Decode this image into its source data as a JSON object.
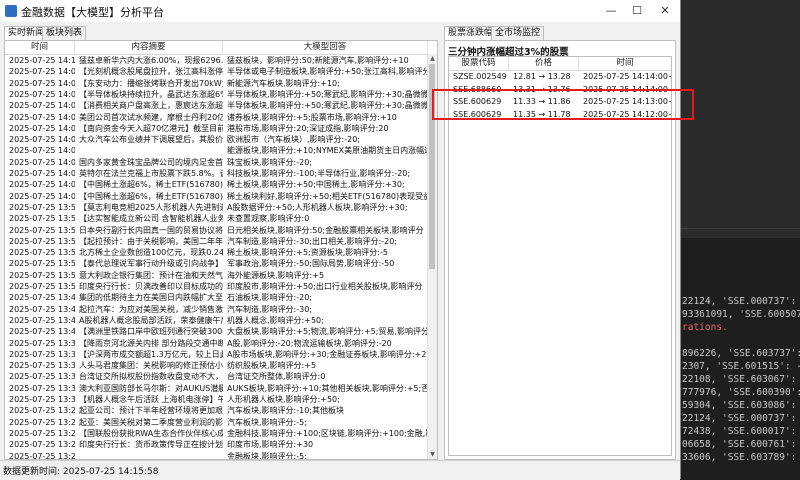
{
  "window": {
    "title": "金融数据【大模型】分析平台",
    "controls": {
      "minimize": "—",
      "maximize": "☐",
      "close": "✕"
    }
  },
  "left_tabs": [
    {
      "label": "实时新闻",
      "active": true
    },
    {
      "label": "板块列表",
      "active": false
    }
  ],
  "right_tabs": [
    {
      "label": "股票涨跌幅",
      "active": true
    },
    {
      "label": "全市场监控",
      "active": false
    }
  ],
  "news_table": {
    "columns": [
      "时间",
      "内容摘要",
      "大模型回答"
    ],
    "rows": [
      [
        "2025-07-25 14:11",
        "猛兹卓新华六内大涨6.00%，现报6296.00元/",
        "猛兹板块，影响评分:50;新能源汽车,影响评分:+10"
      ],
      [
        "2025-07-25 14:08",
        "【光刻机概念股尾盘拉升，张江高科涨停】光刻",
        "半导体或电子制造板块,影响评分:+50;张江高科,影响评分:+10"
      ],
      [
        "2025-07-25 14:07",
        "【东安动力：播缩张烤联合开发出70kW大功率",
        "新能源汽车板块,影响评分:+10;"
      ],
      [
        "2025-07-25 14:06",
        "【半导体板块持续拉升，晶武达东涨超6%】半导",
        "半导体板块,影响评分:+50;寒武纪,影响评分:+30;晶微微微,影响评分"
      ],
      [
        "2025-07-25 14:06",
        "【消费相关商户盘高涨上，惠宸达东涨超6%】半导",
        "半导体板块,影响评分:+50;寒武纪,影响评分:+30;晶微微微,影响评分"
      ],
      [
        "2025-07-25 14:05",
        "美团公司首次试水频建，摩根士丹利20亿元人",
        "诸券板块,影响评分:+5;股票市场,影响评分:+10"
      ],
      [
        "2025-07-25 14:04",
        "【南向资金今天入超70亿港元】截至目前，南向",
        "港股市场,影响评分:20;深证成指,影响评分:20"
      ],
      [
        "2025-07-25 14:04",
        "大众汽车公布业绩并下调展望后，其股价在法兰",
        "欧洲股市（汽车板块）,影响评分:-20;"
      ],
      [
        "2025-07-25 14:04",
        "",
        "能源板块,影响评分:+10;NYMEX美原油期货主日内涨幅达到1.08"
      ],
      [
        "2025-07-25 14:04",
        "国内多家黄金珠宝品牌公司的境内足金首饰价格",
        "珠宝板块,影响评分:-20;"
      ],
      [
        "2025-07-25 14:00",
        "英特尔在法兰克福上市股票下跌5.8%。该公司",
        "科技板块,影响评分:-100;半导体行业,影响评分:-20;"
      ],
      [
        "2025-07-25 14:00",
        "【中国稀土涨超6%，稀土ETF(516780)持有该股",
        "稀土板块,影响评分:+50;中国稀土,影响评分:+30;"
      ],
      [
        "2025-07-25 14:00",
        "【中国稀土涨超6%，稀土ETF(516780)持有该股",
        "稀土板块利好,影响评分:+50;相关ETF(516780)表现受益,影响评分"
      ],
      [
        "2025-07-25 13:59",
        "【莫志利电竞相2025人形机器人先进制造技术论",
        "A股数据评分:+50;人形机器人板块,影响评分:+30;"
      ],
      [
        "2025-07-25 13:56",
        "【达实智能成立新公司 含智能机器人业务】企",
        "未查置观察,影响评分:0"
      ],
      [
        "2025-07-25 13:56",
        "日本央行副行长内田真一国的贸易协议将减少不确",
        "日元相关板块,影响评分:50;金融股票相关板块,影响评分"
      ],
      [
        "2025-07-25 13:56",
        "【起拉预计：由于关税影响，美国二年年度汽车",
        "汽车制造,影响评分:-30;出口相关,影响评分:-20;"
      ],
      [
        "2025-07-25 13:54",
        "北方稀土企业数创造100亿元，现跌0.24%。",
        "稀土板块,影响评分:+5;资源板块,影响评分:-5"
      ],
      [
        "2025-07-25 13:54",
        "【泰代总理说军事行动升级或引向战争】泰国CCT",
        "军事政治,影响评分:-50;国际局势,影响评分:-50"
      ],
      [
        "2025-07-25 13:54",
        "意大利政企银行集团：预计在油和天然气产量将",
        "海外能源板块,影响评分:+5"
      ],
      [
        "2025-07-25 13:54",
        "印度央行行长：贝满改善印以目标成功的。",
        "印度股市,影响评分:+50;出口行业相关股板块,影响评分"
      ],
      [
        "2025-07-25 13:45",
        "集团的低期待主力在美国日内跌幅扩大至4%。",
        "石油板块,影响评分:-20;"
      ],
      [
        "2025-07-25 13:45",
        "起拉汽车：为应对美国关税，减少销售激励措施",
        "汽车制造,影响评分:-30;"
      ],
      [
        "2025-07-25 13:44",
        "A股机器人概念股局部活跃，荣泰健康午后涨停，",
        "机器人概念,影响评分:+50;"
      ],
      [
        "2025-07-25 13:42",
        "【满洲里铁路口岸中欧班列通行突破30000列】",
        "大盘板块,影响评分:+5;物流,影响评分:+5;贸易,影响评分:+5"
      ],
      [
        "2025-07-25 13:39",
        "【降雨京河北源关内排 部分路段交通中断】7月",
        "A股,影响评分:-20;物流运输板块,影响评分:-20"
      ],
      [
        "2025-07-25 13:39",
        "【沪深两市成交额超1.3万亿元，较上日此时增",
        "A股市场板块,影响评分:+30;金融证券板块,影响评分:+20"
      ],
      [
        "2025-07-25 13:39",
        "人头马君度集团：关税影响的修正预估小于预期",
        "纺织股板块,影响评分:+5"
      ],
      [
        "2025-07-25 13:34",
        "台湾证交所拟权股份指数收盘变动不大，报23,3",
        "台湾证交所整体,影响评分:0"
      ],
      [
        "2025-07-25 13:34",
        "澳大利亚国防部长马尔斯：对AUKUS潜艇项目的",
        "AUKS板块,影响评分:+10;其他相关板块,影响评分:+5;否则"
      ],
      [
        "2025-07-25 13:32",
        "【机器人概念午后活跃 上海机电涨停】午后机器",
        "人形机器人板块,影响评分:+50;"
      ],
      [
        "2025-07-25 13:29",
        "起亚公司：预计下半年经营环境将更加艰难。",
        "汽车板块,影响评分:-10;其他板块"
      ],
      [
        "2025-07-25 13:29",
        "起亚：美国关税对第二季度营业利润的影响为7",
        "汽车板块,影响评分:-5;"
      ],
      [
        "2025-07-25 13:28",
        "【国联股份获批RWA生态合作伙伴核心成员 将",
        "金融科技,影响评分:+100;区块链,影响评分:+100;金融,影响评分"
      ],
      [
        "2025-07-25 13:25",
        "印度央行行长：货币政策传导正在按计划进行，将",
        "印度市场,影响评分:+30"
      ],
      [
        "2025-07-25 13:23",
        "",
        "金融板块,影响评分:-5;"
      ],
      [
        "2025-07-25 13:22",
        "【招商蛇口、中银投资联合体27.3亿竞得浦东新",
        "房地产板块,影响评分:+10;中东地区板块,影响评分"
      ],
      [
        "2025-07-25 13:21",
        "",
        "A股相关投资板块,影响评分:-50;绿城,影响评分"
      ]
    ]
  },
  "stock_panel": {
    "section_title": "三分钟内涨幅超过3%的股票",
    "columns": [
      "股票代码",
      "价格",
      "时间"
    ],
    "rows": [
      [
        "SZSE.002549",
        "12.81 → 13.28",
        "2025-07-25 14:14:00+0"
      ],
      [
        "SSE.688660",
        "13.31 → 13.76",
        "2025-07-25 14:14:00+0"
      ],
      [
        "SSE.600629",
        "11.33 → 11.86",
        "2025-07-25 14:13:00+0"
      ],
      [
        "SSE.600629",
        "11.35 → 11.78",
        "2025-07-25 14:12:00+0"
      ]
    ]
  },
  "status_bar": {
    "text": "数据更新时间: 2025-07-25 14:15:58"
  },
  "terminal": {
    "lines": [
      {
        "text": "22124, 'SSE.000737': -0.00",
        "style": "normal"
      },
      {
        "text": "93361091, 'SSE.600507': -0",
        "style": "normal"
      },
      {
        "text": "rations.",
        "style": "err"
      },
      {
        "text": "896226, 'SSE.603737': -0.0",
        "style": "normal"
      },
      {
        "text": "2307, 'SSE.601515': -0.007",
        "style": "normal"
      },
      {
        "text": "22108, 'SSE.603067': -0.0",
        "style": "normal"
      },
      {
        "text": "777976, 'SSE.600390': -0.0",
        "style": "normal"
      },
      {
        "text": "59304, 'SSE.603086': -0.0",
        "style": "normal"
      },
      {
        "text": "22124, 'SSE.000737': -0.00",
        "style": "normal"
      },
      {
        "text": "72438, 'SSE.600017': -0.0",
        "style": "normal"
      },
      {
        "text": "06658, 'SSE.600761': 0.004",
        "style": "normal"
      },
      {
        "text": "33606, 'SSE.603789': 0.001",
        "style": "normal"
      }
    ]
  }
}
